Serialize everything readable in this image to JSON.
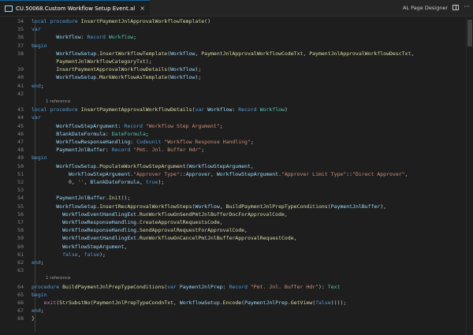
{
  "tab": {
    "title": "CU.50068.Custom Workflow Setup Event.al",
    "close": "×"
  },
  "toolbar": {
    "designer_label": "AL Page Designer",
    "more": "···"
  },
  "codelens": {
    "text": "1 reference"
  },
  "lines": [
    {
      "n": "34",
      "segs": [
        [
          "kw",
          "local procedure "
        ],
        [
          "fn",
          "InsertPaymentJnlApprovalWorkflowTemplate"
        ],
        [
          "pl",
          "()"
        ]
      ]
    },
    {
      "n": "35",
      "segs": [
        [
          "kw",
          "var"
        ]
      ]
    },
    {
      "n": "36",
      "segs": [
        [
          "vr",
          "        Workflow"
        ],
        [
          "pl",
          ": "
        ],
        [
          "kw",
          "Record "
        ],
        [
          "ty",
          "Workflow"
        ],
        [
          "pl",
          ";"
        ]
      ]
    },
    {
      "n": "37",
      "segs": [
        [
          "kw",
          "begin"
        ]
      ]
    },
    {
      "n": "38",
      "segs": [
        [
          "vr",
          "        WorkflowSetup"
        ],
        [
          "pl",
          "."
        ],
        [
          "fn",
          "InsertWorkflowTemplate"
        ],
        [
          "pl",
          "("
        ],
        [
          "vr",
          "Workflow"
        ],
        [
          "pl",
          ", "
        ],
        [
          "fn",
          "PaymentJnlApprovalWorkflowCodeTxt"
        ],
        [
          "pl",
          ", "
        ],
        [
          "fn",
          "PaymentJnlApprovalWorkflowDescTxt"
        ],
        [
          "pl",
          ","
        ]
      ]
    },
    {
      "n": "",
      "segs": [
        [
          "fn",
          "        PaymentJnlWorkflowCategoryTxt"
        ],
        [
          "pl",
          ");"
        ]
      ]
    },
    {
      "n": "39",
      "segs": [
        [
          "fn",
          "        InsertPaymentApprovalWorkflowDetails"
        ],
        [
          "pl",
          "("
        ],
        [
          "vr",
          "Workflow"
        ],
        [
          "pl",
          ");"
        ]
      ]
    },
    {
      "n": "40",
      "segs": [
        [
          "vr",
          "        WorkflowSetup"
        ],
        [
          "pl",
          "."
        ],
        [
          "fn",
          "MarkWorkflowAsTemplate"
        ],
        [
          "pl",
          "("
        ],
        [
          "vr",
          "Workflow"
        ],
        [
          "pl",
          ");"
        ]
      ]
    },
    {
      "n": "41",
      "segs": [
        [
          "kw",
          "end"
        ],
        [
          "pl",
          ";"
        ]
      ]
    },
    {
      "n": "42",
      "segs": []
    },
    {
      "lens": true
    },
    {
      "n": "43",
      "segs": [
        [
          "kw",
          "local procedure "
        ],
        [
          "fn",
          "InsertPaymentApprovalWorkflowDetails"
        ],
        [
          "pl",
          "("
        ],
        [
          "kw",
          "var "
        ],
        [
          "vr",
          "Workflow"
        ],
        [
          "pl",
          ": "
        ],
        [
          "kw",
          "Record "
        ],
        [
          "ty",
          "Workflow"
        ],
        [
          "pl",
          ")"
        ]
      ]
    },
    {
      "n": "44",
      "segs": [
        [
          "kw",
          "var"
        ]
      ]
    },
    {
      "n": "45",
      "segs": [
        [
          "vr",
          "        WorkflowStepArgument"
        ],
        [
          "pl",
          ": "
        ],
        [
          "kw",
          "Record "
        ],
        [
          "st",
          "\"Workflow Step Argument\""
        ],
        [
          "pl",
          ";"
        ]
      ]
    },
    {
      "n": "46",
      "segs": [
        [
          "vr",
          "        BlankDateFormula"
        ],
        [
          "pl",
          ": "
        ],
        [
          "ty",
          "DateFormula"
        ],
        [
          "pl",
          ";"
        ]
      ]
    },
    {
      "n": "47",
      "segs": [
        [
          "vr",
          "        WorkflowResponseHandling"
        ],
        [
          "pl",
          ": "
        ],
        [
          "kw",
          "Codeunit "
        ],
        [
          "st",
          "\"Workflow Response Handling\""
        ],
        [
          "pl",
          ";"
        ]
      ]
    },
    {
      "n": "48",
      "segs": [
        [
          "vr",
          "        PaymentJnlBuffer"
        ],
        [
          "pl",
          ": "
        ],
        [
          "kw",
          "Record "
        ],
        [
          "st",
          "\"Pmt. Jnl. Buffer Hdr\""
        ],
        [
          "pl",
          ";"
        ]
      ]
    },
    {
      "n": "49",
      "segs": [
        [
          "kw",
          "begin"
        ]
      ]
    },
    {
      "n": "50",
      "segs": [
        [
          "vr",
          "        WorkflowSetup"
        ],
        [
          "pl",
          "."
        ],
        [
          "fn",
          "PopulateWorkflowStepArgument"
        ],
        [
          "pl",
          "("
        ],
        [
          "vr",
          "WorkflowStepArgument"
        ],
        [
          "pl",
          ","
        ]
      ]
    },
    {
      "n": "51",
      "segs": [
        [
          "vr",
          "            WorkflowStepArgument"
        ],
        [
          "pl",
          "."
        ],
        [
          "st",
          "\"Approver Type\""
        ],
        [
          "pl",
          "::"
        ],
        [
          "vr",
          "Approver"
        ],
        [
          "pl",
          ", "
        ],
        [
          "vr",
          "WorkflowStepArgument"
        ],
        [
          "pl",
          "."
        ],
        [
          "st",
          "\"Approver Limit Type\""
        ],
        [
          "pl",
          "::"
        ],
        [
          "st",
          "\"Direct Approver\""
        ],
        [
          "pl",
          ","
        ]
      ]
    },
    {
      "n": "52",
      "segs": [
        [
          "nu",
          "            0"
        ],
        [
          "pl",
          ", "
        ],
        [
          "st",
          "''"
        ],
        [
          "pl",
          ", "
        ],
        [
          "vr",
          "BlankDateFormula"
        ],
        [
          "pl",
          ", "
        ],
        [
          "kw",
          "true"
        ],
        [
          "pl",
          ");"
        ]
      ]
    },
    {
      "n": "53",
      "segs": []
    },
    {
      "n": "54",
      "segs": [
        [
          "vr",
          "        PaymentJnlBuffer"
        ],
        [
          "pl",
          "."
        ],
        [
          "fn",
          "Init"
        ],
        [
          "pl",
          "();"
        ]
      ]
    },
    {
      "n": "55",
      "segs": [
        [
          "vr",
          "        WorkflowSetup"
        ],
        [
          "pl",
          "."
        ],
        [
          "fn",
          "InsertRecApprovalWorkflowSteps"
        ],
        [
          "pl",
          "("
        ],
        [
          "vr",
          "Workflow"
        ],
        [
          "pl",
          ", "
        ],
        [
          "fn",
          "BuildPaymentJnlPrepTypeConditions"
        ],
        [
          "pl",
          "("
        ],
        [
          "vr",
          "PaymentJnlBuffer"
        ],
        [
          "pl",
          "),"
        ]
      ]
    },
    {
      "n": "56",
      "segs": [
        [
          "vr",
          "          WorkflowEventHandlingExt"
        ],
        [
          "pl",
          "."
        ],
        [
          "fn",
          "RunWorkflowOnSendPmtJnlBufferDocForApprovalCode"
        ],
        [
          "pl",
          ","
        ]
      ]
    },
    {
      "n": "57",
      "segs": [
        [
          "vr",
          "          WorkflowResponseHandling"
        ],
        [
          "pl",
          "."
        ],
        [
          "fn",
          "CreateApprovalRequestsCode"
        ],
        [
          "pl",
          ","
        ]
      ]
    },
    {
      "n": "58",
      "segs": [
        [
          "vr",
          "          WorkflowResponseHandling"
        ],
        [
          "pl",
          "."
        ],
        [
          "fn",
          "SendApprovalRequestForApprovalCode"
        ],
        [
          "pl",
          ","
        ]
      ]
    },
    {
      "n": "59",
      "segs": [
        [
          "vr",
          "          WorkflowEventHandlingExt"
        ],
        [
          "pl",
          "."
        ],
        [
          "fn",
          "RunWorkflowOnCancelPmtJnlBufferApprovalRequestCode"
        ],
        [
          "pl",
          ","
        ]
      ]
    },
    {
      "n": "60",
      "segs": [
        [
          "vr",
          "          WorkflowStepArgument"
        ],
        [
          "pl",
          ","
        ]
      ]
    },
    {
      "n": "61",
      "segs": [
        [
          "kw",
          "          false"
        ],
        [
          "pl",
          ", "
        ],
        [
          "kw",
          "false"
        ],
        [
          "pl",
          ");"
        ]
      ]
    },
    {
      "n": "62",
      "segs": [
        [
          "kw",
          "end"
        ],
        [
          "pl",
          ";"
        ]
      ]
    },
    {
      "n": "63",
      "segs": []
    },
    {
      "lens": true
    },
    {
      "n": "64",
      "segs": [
        [
          "kw",
          "procedure "
        ],
        [
          "fn",
          "BuildPaymentJnlPrepTypeConditions"
        ],
        [
          "pl",
          "("
        ],
        [
          "kw",
          "var "
        ],
        [
          "vr",
          "PaymentJnlPrep"
        ],
        [
          "pl",
          ": "
        ],
        [
          "kw",
          "Record "
        ],
        [
          "st",
          "\"Pmt. Jnl. Buffer Hdr\""
        ],
        [
          "pl",
          "): "
        ],
        [
          "ty",
          "Text"
        ]
      ]
    },
    {
      "n": "65",
      "segs": [
        [
          "kw",
          "begin"
        ]
      ]
    },
    {
      "n": "66",
      "segs": [
        [
          "pc",
          "    exit"
        ],
        [
          "pl",
          "("
        ],
        [
          "fn",
          "StrSubstNo"
        ],
        [
          "pl",
          "("
        ],
        [
          "fn",
          "PaymentJnlPrepTypeCondnTxt"
        ],
        [
          "pl",
          ", "
        ],
        [
          "vr",
          "WorkflowSetup"
        ],
        [
          "pl",
          "."
        ],
        [
          "fn",
          "Encode"
        ],
        [
          "pl",
          "("
        ],
        [
          "vr",
          "PaymentJnlPrep"
        ],
        [
          "pl",
          "."
        ],
        [
          "fn",
          "GetView"
        ],
        [
          "pl",
          "("
        ],
        [
          "kw",
          "false"
        ],
        [
          "pl",
          "))));"
        ]
      ]
    },
    {
      "n": "67",
      "segs": [
        [
          "kw",
          "end"
        ],
        [
          "pl",
          ";"
        ]
      ]
    },
    {
      "n": "68",
      "segs": [
        [
          "pl",
          "}"
        ]
      ]
    }
  ]
}
